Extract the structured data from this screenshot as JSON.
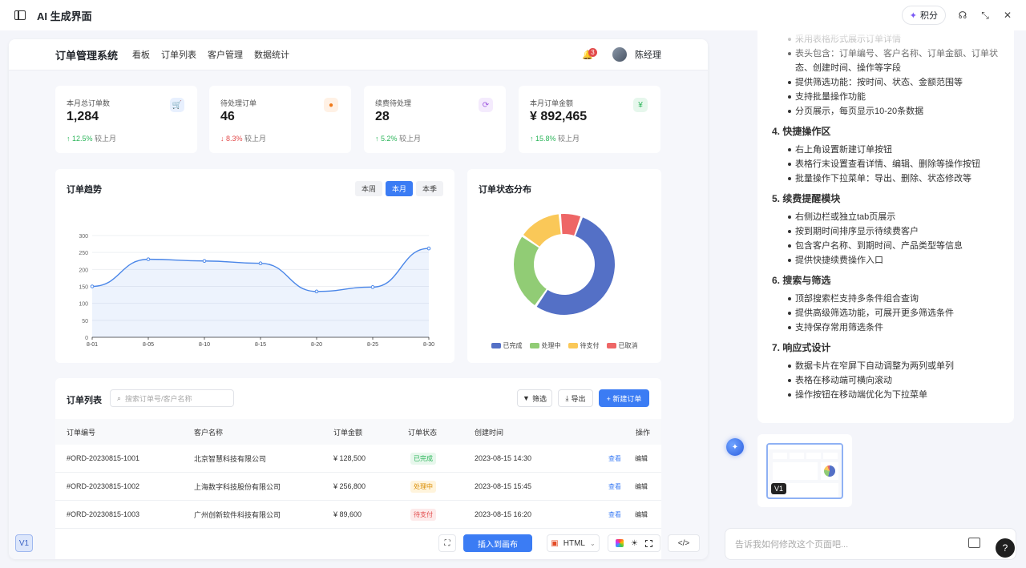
{
  "app": {
    "title": "AI 生成界面",
    "points_label": "积分"
  },
  "dashboard": {
    "brand": "订单管理系统",
    "nav": [
      "看板",
      "订单列表",
      "客户管理",
      "数据统计"
    ],
    "notifications": "3",
    "user": "陈经理",
    "stats": [
      {
        "label": "本月总订单数",
        "value": "1,284",
        "change": "↑ 12.5%",
        "suffix": "较上月",
        "dir": "up",
        "icon": "cart-icon",
        "glyph": "🛒",
        "icon_color": "#3b7cf4",
        "icon_bg": "#e8f0fe"
      },
      {
        "label": "待处理订单",
        "value": "46",
        "change": "↓ 8.3%",
        "suffix": "较上月",
        "dir": "down",
        "icon": "clock-icon",
        "glyph": "●",
        "icon_color": "#f07a1a",
        "icon_bg": "#fff1e5"
      },
      {
        "label": "续费待处理",
        "value": "28",
        "change": "↑ 5.2%",
        "suffix": "较上月",
        "dir": "up",
        "icon": "refresh-icon",
        "glyph": "⟳",
        "icon_color": "#a05ce0",
        "icon_bg": "#f4ebfd"
      },
      {
        "label": "本月订单金额",
        "value": "¥ 892,465",
        "change": "↑ 15.8%",
        "suffix": "较上月",
        "dir": "up",
        "icon": "yuan-icon",
        "glyph": "¥",
        "icon_color": "#2cb55a",
        "icon_bg": "#e6f7ec"
      }
    ],
    "trend_title": "订单趋势",
    "trend_ranges": [
      "本周",
      "本月",
      "本季"
    ],
    "trend_active": 1,
    "status_title": "订单状态分布",
    "list": {
      "title": "订单列表",
      "search_placeholder": "搜索订单号/客户名称",
      "filter": "筛选",
      "export": "导出",
      "new": "+ 新建订单",
      "columns": [
        "订单编号",
        "客户名称",
        "订单金额",
        "订单状态",
        "创建时间",
        "操作"
      ],
      "rows": [
        {
          "id": "#ORD-20230815-1001",
          "customer": "北京智慧科技有限公司",
          "amount": "¥ 128,500",
          "status": "已完成",
          "status_color": "#2cb55a",
          "status_bg": "#e7f7ec",
          "time": "2023-08-15 14:30",
          "view": "查看",
          "edit": "编辑"
        },
        {
          "id": "#ORD-20230815-1002",
          "customer": "上海数字科技股份有限公司",
          "amount": "¥ 256,800",
          "status": "处理中",
          "status_color": "#d98b00",
          "status_bg": "#fff4dc",
          "time": "2023-08-15 15:45",
          "view": "查看",
          "edit": "编辑"
        },
        {
          "id": "#ORD-20230815-1003",
          "customer": "广州创新软件科技有限公司",
          "amount": "¥ 89,600",
          "status": "待支付",
          "status_color": "#e24a4a",
          "status_bg": "#fdeaea",
          "time": "2023-08-15 16:20",
          "view": "查看",
          "edit": "编辑"
        }
      ]
    }
  },
  "toolbar": {
    "version": "V1",
    "insert": "插入到画布",
    "format": "HTML"
  },
  "chat": {
    "sections": [
      {
        "title": "",
        "items": [
          "采用表格形式展示订单详情",
          "表头包含：订单编号、客户名称、订单金额、订单状态、创建时间、操作等字段",
          "提供筛选功能：按时间、状态、金额范围等",
          "支持批量操作功能",
          "分页展示，每页显示10-20条数据"
        ]
      },
      {
        "title": "4. 快捷操作区",
        "items": [
          "右上角设置新建订单按钮",
          "表格行末设置查看详情、编辑、删除等操作按钮",
          "批量操作下拉菜单：导出、删除、状态修改等"
        ]
      },
      {
        "title": "5. 续费提醒模块",
        "items": [
          "右侧边栏或独立tab页展示",
          "按到期时间排序显示待续费客户",
          "包含客户名称、到期时间、产品类型等信息",
          "提供快捷续费操作入口"
        ]
      },
      {
        "title": "6. 搜索与筛选",
        "items": [
          "顶部搜索栏支持多条件组合查询",
          "提供高级筛选功能，可展开更多筛选条件",
          "支持保存常用筛选条件"
        ]
      },
      {
        "title": "7. 响应式设计",
        "items": [
          "数据卡片在窄屏下自动调整为两列或单列",
          "表格在移动端可横向滚动",
          "操作按钮在移动端优化为下拉菜单"
        ]
      }
    ],
    "version_badge": "V1",
    "input_placeholder": "告诉我如何修改这个页面吧..."
  },
  "chart_data": [
    {
      "type": "line",
      "title": "订单趋势",
      "x": [
        "8-01",
        "8-05",
        "8-10",
        "8-15",
        "8-20",
        "8-25",
        "8-30"
      ],
      "y_ticks": [
        0,
        50,
        100,
        150,
        200,
        250,
        300
      ],
      "ylim": [
        0,
        300
      ],
      "series": [
        {
          "values": [
            150,
            230,
            225,
            218,
            135,
            148,
            262
          ]
        }
      ],
      "color": "#4a86e8",
      "grid": true
    },
    {
      "type": "pie",
      "title": "订单状态分布",
      "labels": [
        "已完成",
        "处理中",
        "待支付",
        "已取消"
      ],
      "values": [
        54,
        25,
        14,
        7
      ],
      "colors": [
        "#5470c6",
        "#91cc75",
        "#fac858",
        "#ee6666"
      ],
      "legend": "bottom"
    }
  ]
}
